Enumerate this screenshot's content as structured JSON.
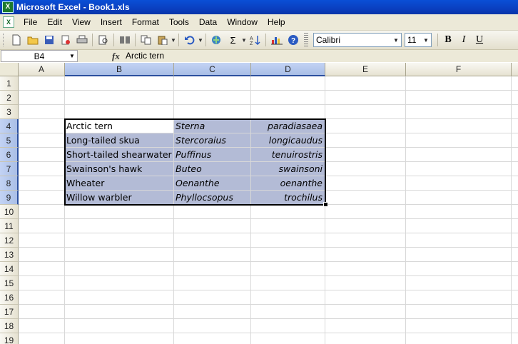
{
  "window": {
    "title": "Microsoft Excel - Book1.xls",
    "app_icon": "excel-icon"
  },
  "menu": [
    {
      "label": "File"
    },
    {
      "label": "Edit"
    },
    {
      "label": "View"
    },
    {
      "label": "Insert"
    },
    {
      "label": "Format"
    },
    {
      "label": "Tools"
    },
    {
      "label": "Data"
    },
    {
      "label": "Window"
    },
    {
      "label": "Help"
    }
  ],
  "toolbar": {
    "font_name": "Calibri",
    "font_size": "11",
    "bold": "B",
    "italic": "I",
    "underline": "U",
    "autosum": "Σ"
  },
  "formula_bar": {
    "name_box": "B4",
    "fx": "fx",
    "content": "Arctic tern"
  },
  "sheet": {
    "columns": [
      "A",
      "B",
      "C",
      "D",
      "E",
      "F"
    ],
    "rows": [
      "1",
      "2",
      "3",
      "4",
      "5",
      "6",
      "7",
      "8",
      "9",
      "10",
      "11",
      "12",
      "13",
      "14",
      "15",
      "16",
      "17",
      "18",
      "19"
    ],
    "selection": "B4:D9",
    "active_cell": "B4",
    "data": [
      {
        "row": "4",
        "b": "Arctic tern",
        "c": "Sterna",
        "d": "paradiasaea"
      },
      {
        "row": "5",
        "b": "Long-tailed skua",
        "c": "Stercoraius",
        "d": "longicaudus"
      },
      {
        "row": "6",
        "b": "Short-tailed shearwater",
        "c": "Puffinus",
        "d": "tenuirostris"
      },
      {
        "row": "7",
        "b": "Swainson's hawk",
        "c": "Buteo",
        "d": "swainsoni"
      },
      {
        "row": "8",
        "b": "Wheater",
        "c": "Oenanthe",
        "d": "oenanthe"
      },
      {
        "row": "9",
        "b": "Willow warbler",
        "c": "Phyllocsopus",
        "d": "trochilus"
      }
    ]
  }
}
